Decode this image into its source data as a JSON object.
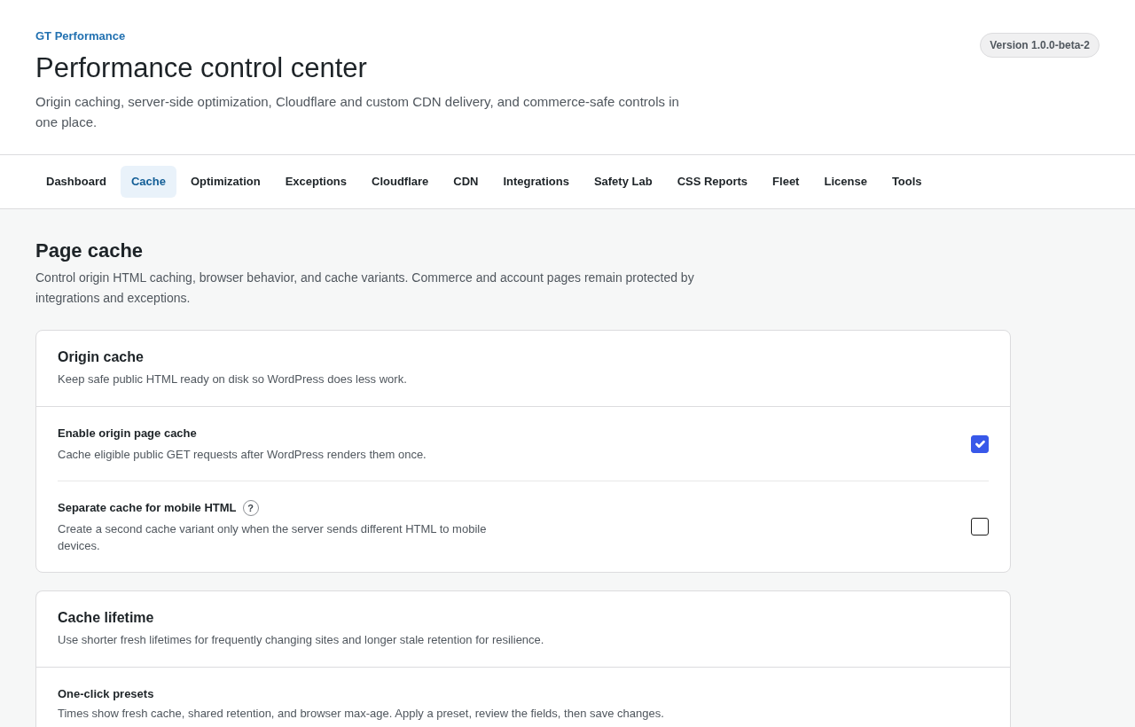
{
  "header": {
    "brand": "GT Performance",
    "title": "Performance control center",
    "subtitle": "Origin caching, server-side optimization, Cloudflare and custom CDN delivery, and commerce-safe controls in one place.",
    "version": "Version 1.0.0-beta-2"
  },
  "tabs": [
    {
      "label": "Dashboard",
      "selected": false
    },
    {
      "label": "Cache",
      "selected": true
    },
    {
      "label": "Optimization",
      "selected": false
    },
    {
      "label": "Exceptions",
      "selected": false
    },
    {
      "label": "Cloudflare",
      "selected": false
    },
    {
      "label": "CDN",
      "selected": false
    },
    {
      "label": "Integrations",
      "selected": false
    },
    {
      "label": "Safety Lab",
      "selected": false
    },
    {
      "label": "CSS Reports",
      "selected": false
    },
    {
      "label": "Fleet",
      "selected": false
    },
    {
      "label": "License",
      "selected": false
    },
    {
      "label": "Tools",
      "selected": false
    }
  ],
  "page": {
    "title": "Page cache",
    "description": "Control origin HTML caching, browser behavior, and cache variants. Commerce and account pages remain protected by integrations and exceptions."
  },
  "sections": [
    {
      "title": "Origin cache",
      "description": "Keep safe public HTML ready on disk so WordPress does less work.",
      "settings": [
        {
          "kind": "checkbox",
          "label": "Enable origin page cache",
          "description": "Cache eligible public GET requests after WordPress renders them once.",
          "checked": true
        },
        {
          "kind": "checkbox",
          "label": "Separate cache for mobile HTML",
          "help": "?",
          "description": "Create a second cache variant only when the server sends different HTML to mobile devices.",
          "checked": false
        }
      ]
    },
    {
      "title": "Cache lifetime",
      "description": "Use shorter fresh lifetimes for frequently changing sites and longer stale retention for resilience.",
      "settings": [
        {
          "kind": "presets",
          "label": "One-click presets",
          "description": "Times show fresh cache, shared retention, and browser max-age. Apply a preset, review the fields, then save changes."
        }
      ]
    }
  ]
}
